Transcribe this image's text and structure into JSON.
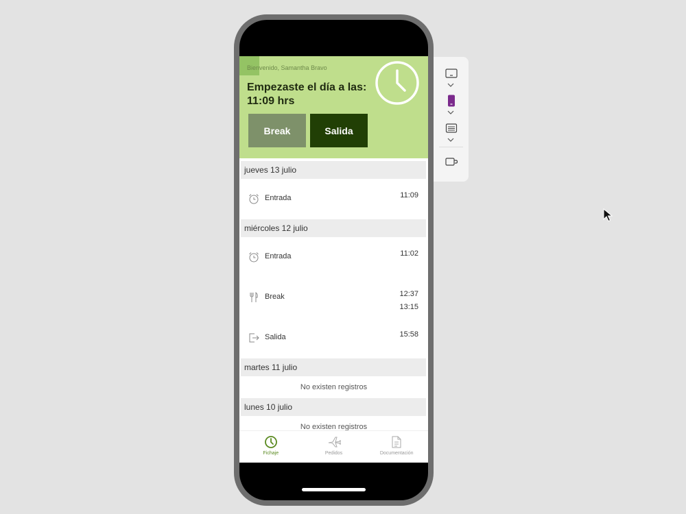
{
  "header": {
    "greeting": "Bienvenido, Samantha Bravo",
    "headline_line1": "Empezaste el día a las:",
    "headline_line2": "11:09 hrs",
    "break_button": "Break",
    "salida_button": "Salida"
  },
  "days": [
    {
      "label": "jueves 13 julio",
      "entries": [
        {
          "icon": "alarm-clock-icon",
          "label": "Entrada",
          "time1": "11:09",
          "time2": ""
        }
      ]
    },
    {
      "label": "miércoles 12 julio",
      "entries": [
        {
          "icon": "alarm-clock-icon",
          "label": "Entrada",
          "time1": "11:02",
          "time2": ""
        },
        {
          "icon": "fork-knife-icon",
          "label": "Break",
          "time1": "12:37",
          "time2": "13:15"
        },
        {
          "icon": "exit-icon",
          "label": "Salida",
          "time1": "15:58",
          "time2": ""
        }
      ]
    },
    {
      "label": "martes 11 julio",
      "empty": "No existen registros"
    },
    {
      "label": "lunes 10 julio",
      "empty": "No existen registros"
    }
  ],
  "nav": {
    "fichaje": "Fichaje",
    "pedidos": "Pedidos",
    "documentacion": "Documentación"
  },
  "colors": {
    "header_bg": "#bfde8c",
    "break_bg": "#7e916a",
    "salida_bg": "#213f05",
    "active_nav": "#5a8a20"
  }
}
